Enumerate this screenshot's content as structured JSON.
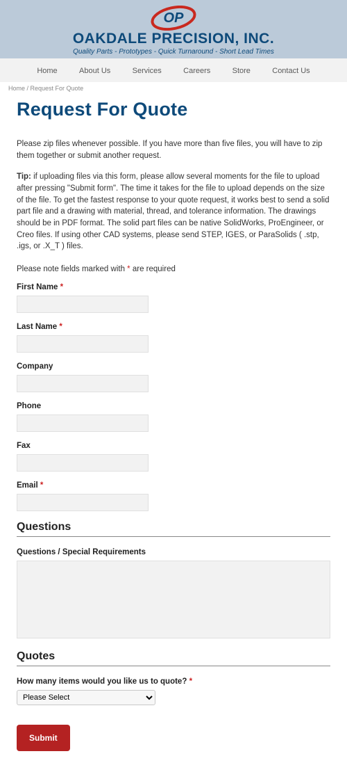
{
  "header": {
    "logo_text": "OP",
    "company_name": "OAKDALE PRECISION, INC.",
    "tagline": "Quality Parts - Prototypes - Quick Turnaround - Short Lead Times"
  },
  "nav": {
    "items": [
      "Home",
      "About Us",
      "Services",
      "Careers",
      "Store",
      "Contact Us"
    ]
  },
  "breadcrumb": {
    "home": "Home",
    "sep": " / ",
    "current": "Request For Quote"
  },
  "page_title": "Request For Quote",
  "intro": "Please zip files whenever possible. If you have more than five files, you will have to zip them together or submit another request.",
  "tip_label": "Tip:",
  "tip_body": " if uploading files via this form, please allow several moments for the file to upload after pressing \"Submit form\". The time it takes for the file to upload depends on the size of the file. To get the fastest response to your quote request, it works best to send a solid part file and a drawing with material, thread, and tolerance information. The drawings should be in PDF format. The solid part files can be native SolidWorks, ProEngineer, or Creo files. If using other CAD systems, please send STEP, IGES, or ParaSolids ( .stp, .igs, or .X_T ) files.",
  "required_note_a": "Please note fields marked with ",
  "required_note_b": " are required",
  "asterisk": "*",
  "labels": {
    "first_name": "First Name ",
    "last_name": "Last Name ",
    "company": "Company",
    "phone": "Phone",
    "fax": "Fax",
    "email": "Email "
  },
  "section_questions": "Questions",
  "questions_label": "Questions / Special Requirements",
  "section_quotes": "Quotes",
  "quote_count_label": "How many items would you like us to quote? ",
  "select_default": "Please Select",
  "submit": "Submit",
  "colors": {
    "brand_blue": "#0e4a7a",
    "brand_red": "#c9291f",
    "submit_red": "#b42222",
    "page_bg": "#bbcad9"
  }
}
